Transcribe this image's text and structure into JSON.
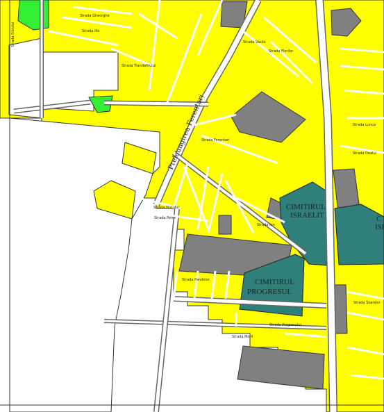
{
  "map": {
    "colors": {
      "built_block": "#ffff00",
      "block_outline": "#333333",
      "road": "#ffffff",
      "road_edge": "#666666",
      "park": "#33ee33",
      "industrial": "#808080",
      "cemetery": "#2f7f7a",
      "background": "#ffffff"
    },
    "labels": {
      "road_preleungirea_ferentari": "Preleungirea Ferentari",
      "area_cimitirul_israelit_1": "CIMITIRUL",
      "area_cimitirul_israelit_2": "ISRAELIT",
      "area_cimitirul_progresul_1": "CIMITIRUL",
      "area_cimitirul_progresul_2": "PROGRESUL",
      "area_right_edge_1": "C",
      "area_right_edge_2": "ISF"
    },
    "street_names": [
      "Strada Sibiului",
      "Strada Gheorghe",
      "Strada Ilie",
      "Strada Trandafirului",
      "Strada Vasile",
      "Strada Florilor",
      "Strada Ferentari",
      "Strada Nucului",
      "Strada Petre",
      "Strada Ion",
      "Strada Pandelor",
      "Strada Morii",
      "Strada Lunca",
      "Strada Dealul",
      "Strada Soarelui",
      "Strada Progresului"
    ]
  }
}
